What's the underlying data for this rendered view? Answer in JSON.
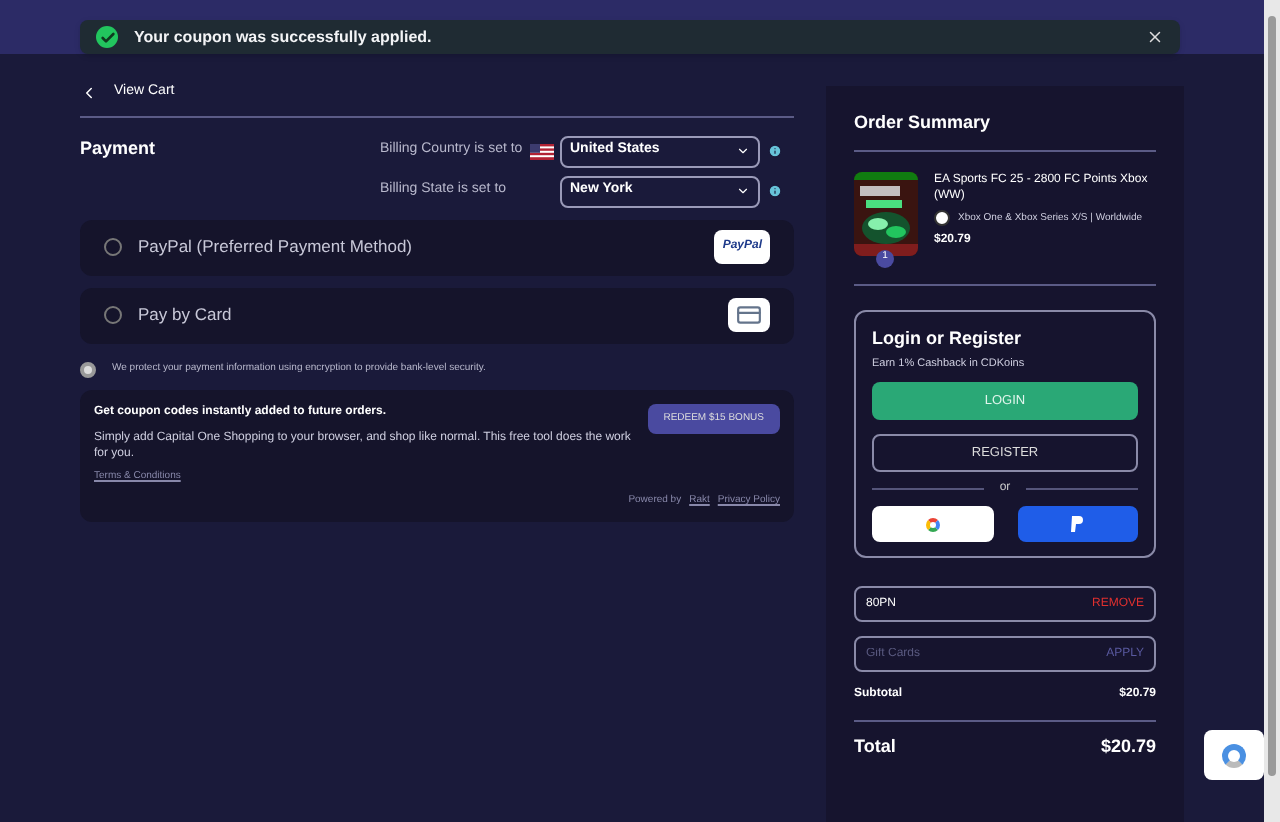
{
  "toast": {
    "message": "Your coupon was successfully applied."
  },
  "back_link": "View Cart",
  "payment": {
    "title": "Payment",
    "billing": [
      {
        "label": "Billing Country is set to",
        "flag": true,
        "value": "United States"
      },
      {
        "label": "Billing State is set to",
        "flag": false,
        "value": "New York"
      }
    ],
    "methods": [
      {
        "label": "PayPal (Preferred Payment Method)",
        "kind": "paypal",
        "selected": false,
        "badge": "PayPal"
      },
      {
        "label": "Pay by Card",
        "kind": "card",
        "selected": false
      }
    ],
    "security_note": "We protect your payment information using encryption to provide bank-level security."
  },
  "promo": {
    "title": "Get coupon codes instantly added to future orders.",
    "text": "Simply add Capital One Shopping to your browser, and shop like normal. This free tool does the work for you.",
    "terms": "Terms & Conditions",
    "button": "REDEEM $15 BONUS",
    "powered_by": "Powered by",
    "brand_link": "Rakt",
    "privacy": "Privacy Policy"
  },
  "order_summary": {
    "title": "Order Summary",
    "item": {
      "kind": "picture",
      "quantity": "1",
      "name": "EA Sports FC 25 - 2800 FC Points Xbox (WW)",
      "platform": "Xbox One & Xbox Series X/S | Worldwide",
      "price": "$20.79"
    },
    "login": {
      "title": "Login or Register",
      "subtitle": "Earn 1% Cashback in CDKoins",
      "login_button": "LOGIN",
      "register_button": "REGISTER",
      "divider": "or"
    },
    "coupon": {
      "value": "80PN",
      "action": "REMOVE"
    },
    "gift_card": {
      "placeholder": "Gift Cards",
      "action": "APPLY"
    },
    "subtotal": {
      "label": "Subtotal",
      "value": "$20.79"
    },
    "total": {
      "label": "Total",
      "value": "$20.79"
    }
  }
}
